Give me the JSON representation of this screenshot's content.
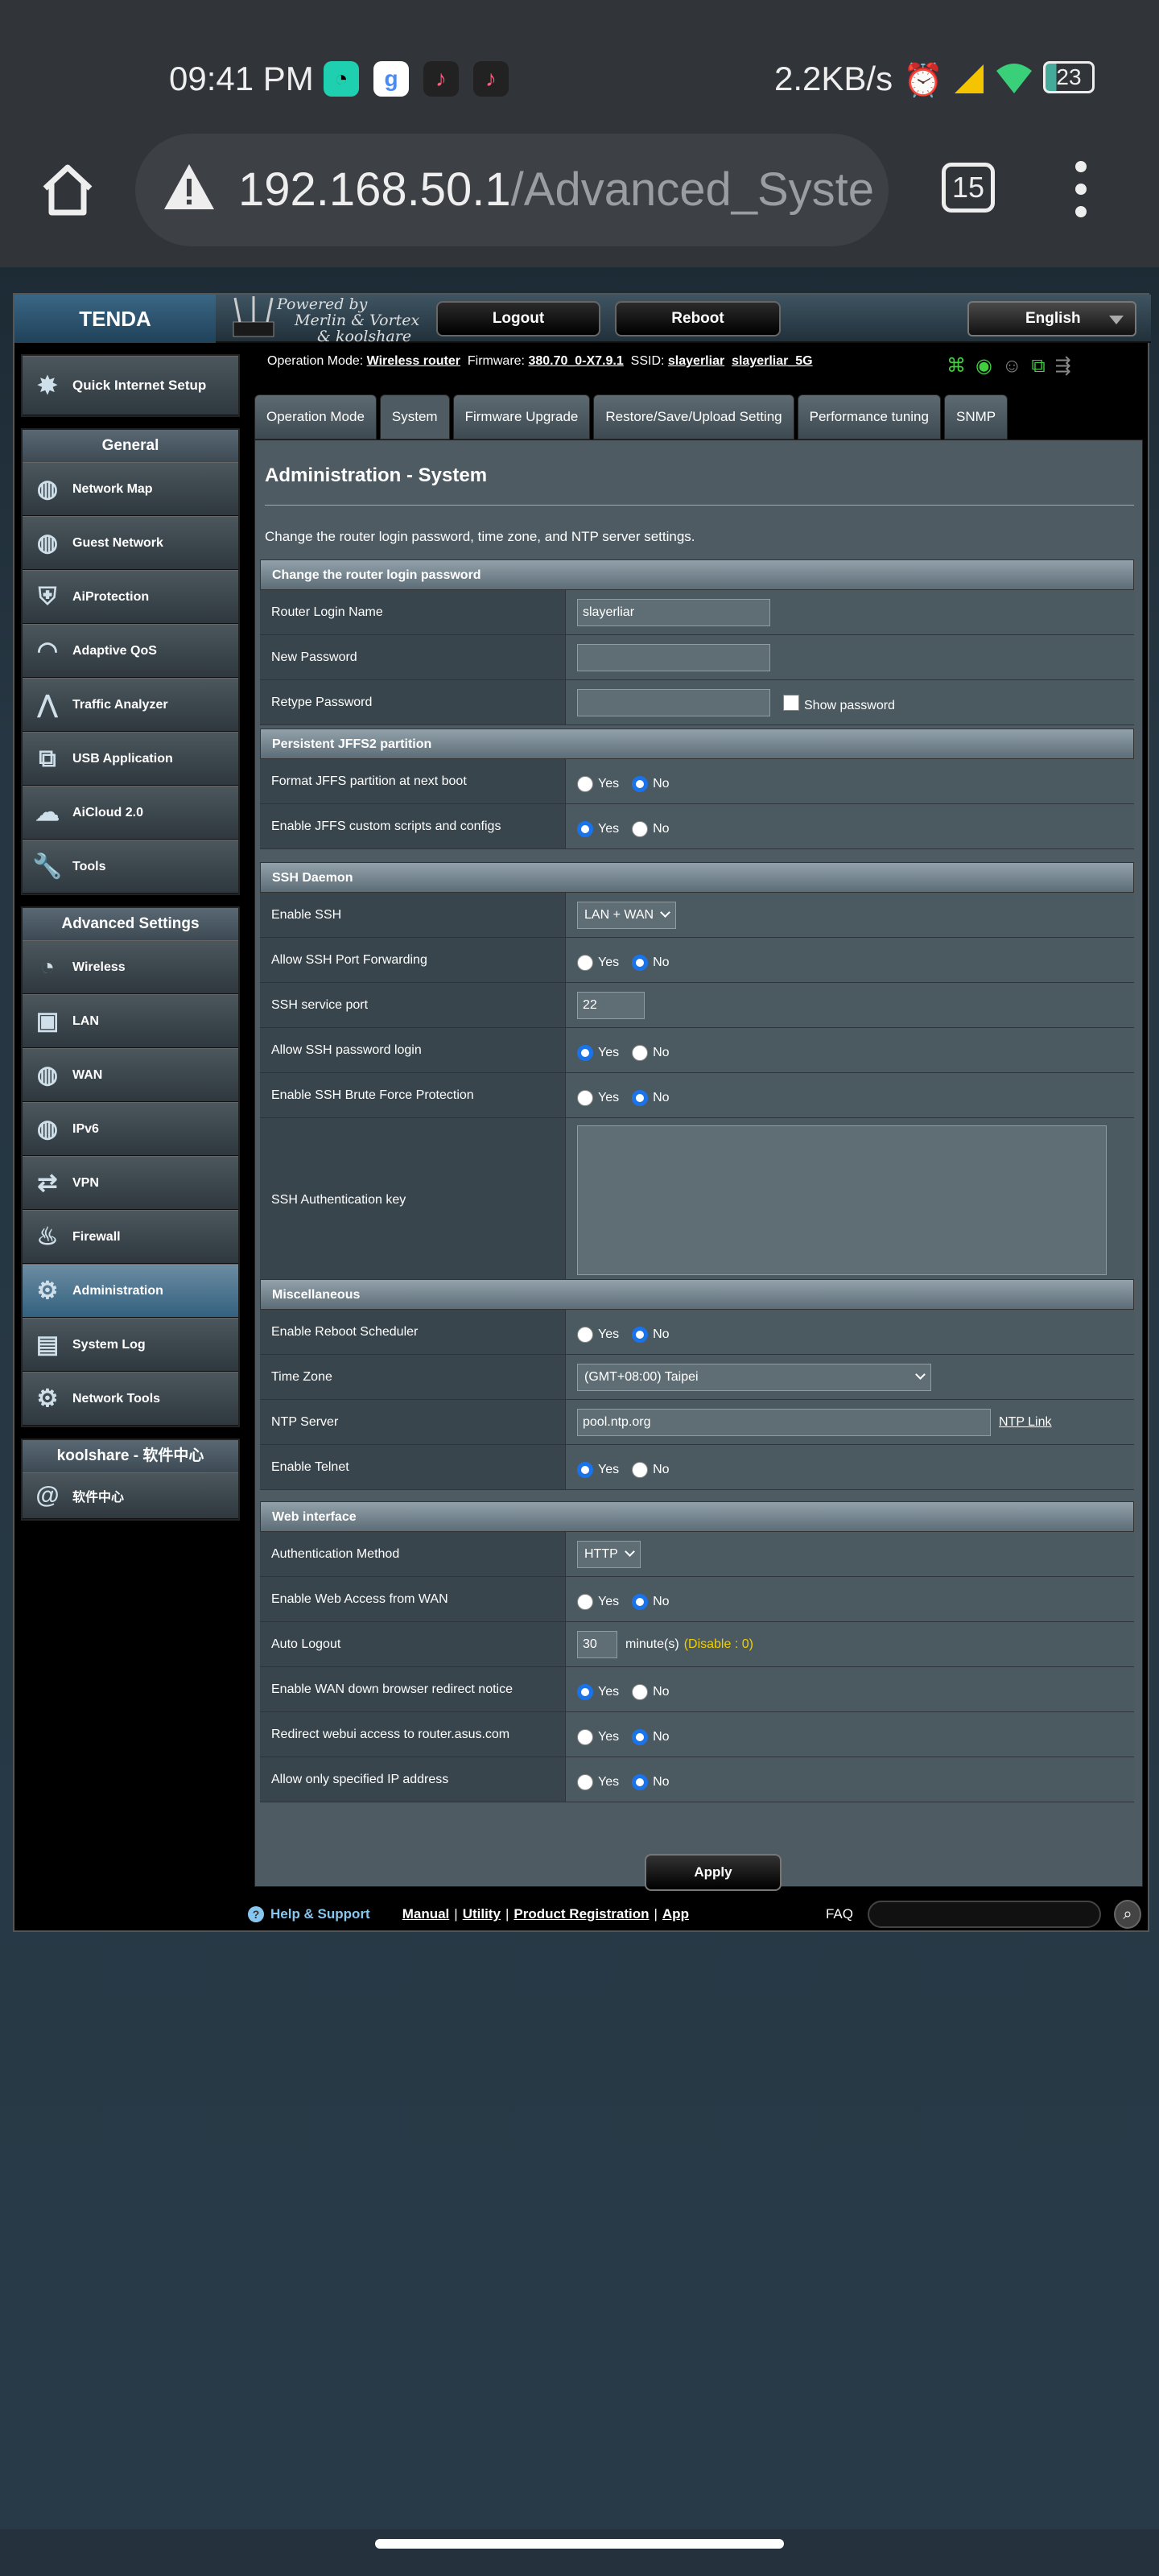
{
  "statusbar": {
    "time": "09:41 PM",
    "speed": "2.2KB/s",
    "battery": "23",
    "icons": [
      "whatsapp-icon",
      "browser-g-icon",
      "tiktok-icon",
      "tiktok-icon",
      "alarm-icon",
      "signal-icon",
      "wifi-icon",
      "battery-icon"
    ]
  },
  "browser": {
    "url_host": "192.168.50.1",
    "url_path": "/Advanced_System",
    "tab_count": "15"
  },
  "router": {
    "brand": "TENDA",
    "powered_by": [
      "Powered by",
      "Merlin & Vortex",
      "& koolshare"
    ],
    "logout": "Logout",
    "reboot": "Reboot",
    "language": "English",
    "sidebar": {
      "quick_setup": "Quick Internet Setup",
      "general_title": "General",
      "general": [
        "Network Map",
        "Guest Network",
        "AiProtection",
        "Adaptive QoS",
        "Traffic Analyzer",
        "USB Application",
        "AiCloud 2.0",
        "Tools"
      ],
      "advanced_title": "Advanced Settings",
      "advanced": [
        "Wireless",
        "LAN",
        "WAN",
        "IPv6",
        "VPN",
        "Firewall",
        "Administration",
        "System Log",
        "Network Tools"
      ],
      "koolshare_title": "koolshare - 软件中心",
      "koolshare": [
        "软件中心"
      ]
    },
    "status": {
      "mode_label": "Operation Mode:",
      "mode": "Wireless router",
      "fw_label": "Firmware:",
      "fw": "380.70_0-X7.9.1",
      "ssid_label": "SSID:",
      "ssid1": "slayerliar",
      "ssid2": "slayerliar_5G"
    },
    "tabs": [
      "Operation Mode",
      "System",
      "Firmware Upgrade",
      "Restore/Save/Upload Setting",
      "Performance tuning",
      "SNMP"
    ],
    "title": "Administration - System",
    "description": "Change the router login password, time zone, and NTP server settings.",
    "sections": {
      "login": {
        "head": "Change the router login password",
        "name_label": "Router Login Name",
        "name_value": "slayerliar",
        "newpw_label": "New Password",
        "retype_label": "Retype Password",
        "show_pw": "Show password"
      },
      "jffs": {
        "head": "Persistent JFFS2 partition",
        "format_label": "Format JFFS partition at next boot",
        "scripts_label": "Enable JFFS custom scripts and configs"
      },
      "ssh": {
        "head": "SSH Daemon",
        "enable_label": "Enable SSH",
        "enable_value": "LAN + WAN",
        "fwd_label": "Allow SSH Port Forwarding",
        "port_label": "SSH service port",
        "port_value": "22",
        "pwlogin_label": "Allow SSH password login",
        "brute_label": "Enable SSH Brute Force Protection",
        "key_label": "SSH Authentication key"
      },
      "misc": {
        "head": "Miscellaneous",
        "reboot_label": "Enable Reboot Scheduler",
        "tz_label": "Time Zone",
        "tz_value": "(GMT+08:00) Taipei",
        "ntp_label": "NTP Server",
        "ntp_value": "pool.ntp.org",
        "ntp_link": "NTP Link",
        "telnet_label": "Enable Telnet"
      },
      "web": {
        "head": "Web interface",
        "auth_label": "Authentication Method",
        "auth_value": "HTTP",
        "wan_label": "Enable Web Access from WAN",
        "logout_label": "Auto Logout",
        "logout_value": "30",
        "logout_unit": "minute(s)",
        "logout_hint": "(Disable : 0)",
        "redirect_label": "Enable WAN down browser redirect notice",
        "asus_label": "Redirect webui access to router.asus.com",
        "ip_label": "Allow only specified IP address"
      }
    },
    "yes": "Yes",
    "no": "No",
    "apply": "Apply",
    "footer": {
      "help": "Help & Support",
      "links": [
        "Manual",
        "Utility",
        "Product Registration",
        "App"
      ],
      "faq": "FAQ"
    },
    "hint_color": "#f0d000"
  }
}
